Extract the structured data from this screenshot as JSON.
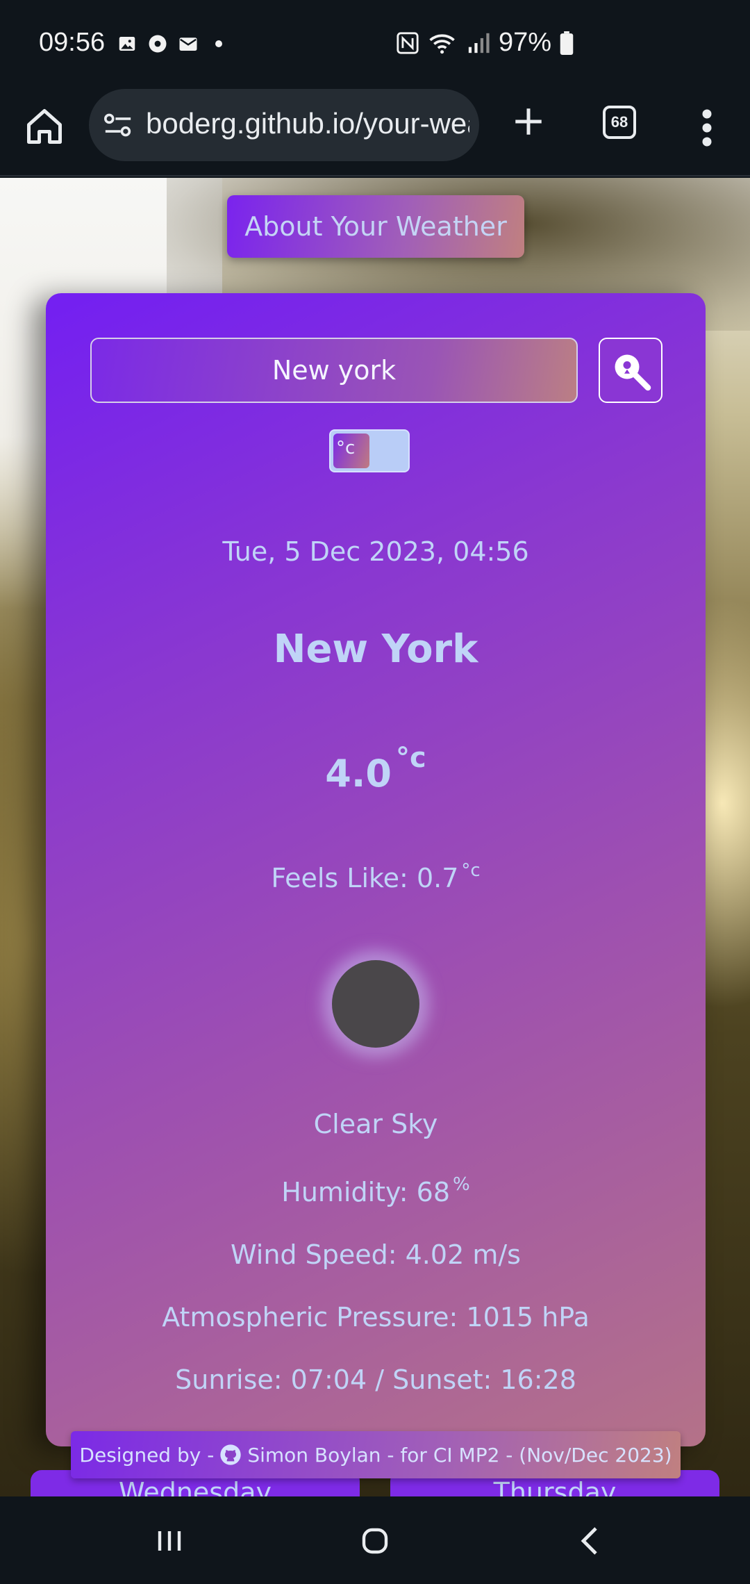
{
  "status_bar": {
    "time": "09:56",
    "battery": "97%"
  },
  "browser": {
    "url": "boderg.github.io/your-weather",
    "tab_count": "68"
  },
  "page": {
    "about_button": "About Your Weather",
    "search": {
      "value": "New york"
    },
    "unit_toggle_label": "°c",
    "date_time": "Tue, 5 Dec 2023, 04:56",
    "city": "New York",
    "temperature": "4.0",
    "temperature_unit": "°c",
    "feels_like_label": "Feels Like: 0.7",
    "feels_like_unit": "°c",
    "description": "Clear Sky",
    "humidity_label": "Humidity: 68",
    "humidity_unit": "%",
    "wind": "Wind Speed: 4.02 m/s",
    "pressure": "Atmospheric Pressure: 1015 hPa",
    "sun_times": "Sunrise: 07:04 / Sunset: 16:28",
    "credit_prefix": "Designed by -",
    "credit_text": "Simon Boylan - for CI MP2 - (Nov/Dec 2023)",
    "day_tabs": [
      "Wednesday",
      "Thursday"
    ]
  },
  "colors": {
    "card_start": "#731ff2",
    "card_end": "#b47288",
    "text": "#c0d4f7"
  }
}
